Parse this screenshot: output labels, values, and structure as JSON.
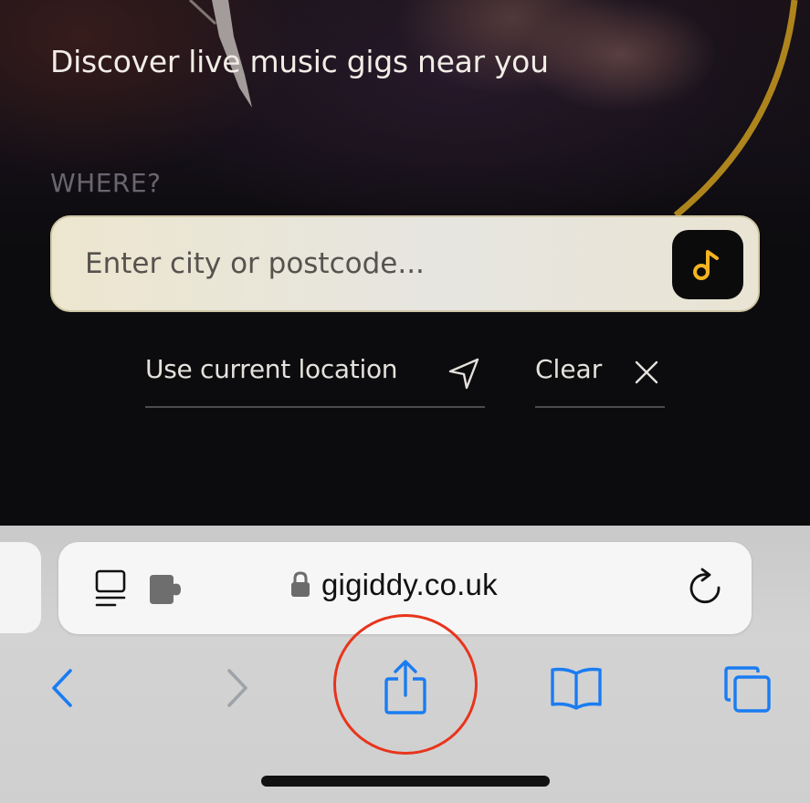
{
  "page": {
    "headline": "Discover live music gigs near you",
    "where_label": "WHERE?",
    "search": {
      "placeholder": "Enter city or postcode...",
      "value": ""
    },
    "use_location_label": "Use current location",
    "clear_label": "Clear"
  },
  "browser": {
    "url": "gigiddy.co.uk",
    "icons": {
      "reader": "reader-mode-icon",
      "extension": "extension-puzzle-icon",
      "lock": "lock-icon",
      "reload": "reload-icon",
      "back": "chevron-left-icon",
      "forward": "chevron-right-icon",
      "share": "share-icon",
      "bookmarks": "book-icon",
      "tabs": "tabs-icon"
    }
  },
  "colors": {
    "accent_blue": "#1a7cf2",
    "highlight_ring": "#e8341c",
    "music_note": "#f2b420",
    "gold_arc": "#c99a1e"
  }
}
